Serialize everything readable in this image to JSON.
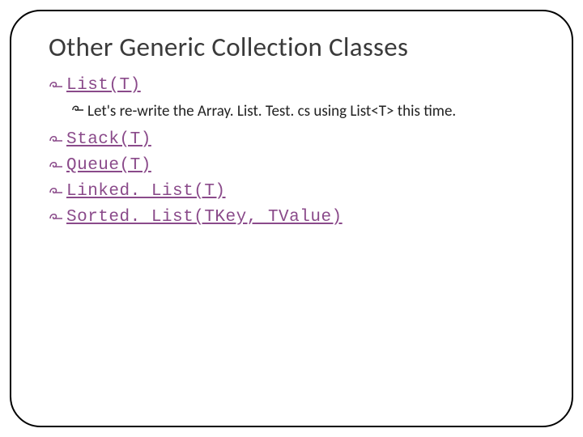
{
  "slide": {
    "title": "Other Generic Collection Classes",
    "items": [
      {
        "label": "List(T)"
      },
      {
        "label": "Let's re-write the Array. List. Test. cs using List<T> this time."
      },
      {
        "label": "Stack(T)"
      },
      {
        "label": "Queue(T)"
      },
      {
        "label": "Linked. List(T)"
      },
      {
        "label": "Sorted. List(TKey, TValue)"
      }
    ]
  }
}
